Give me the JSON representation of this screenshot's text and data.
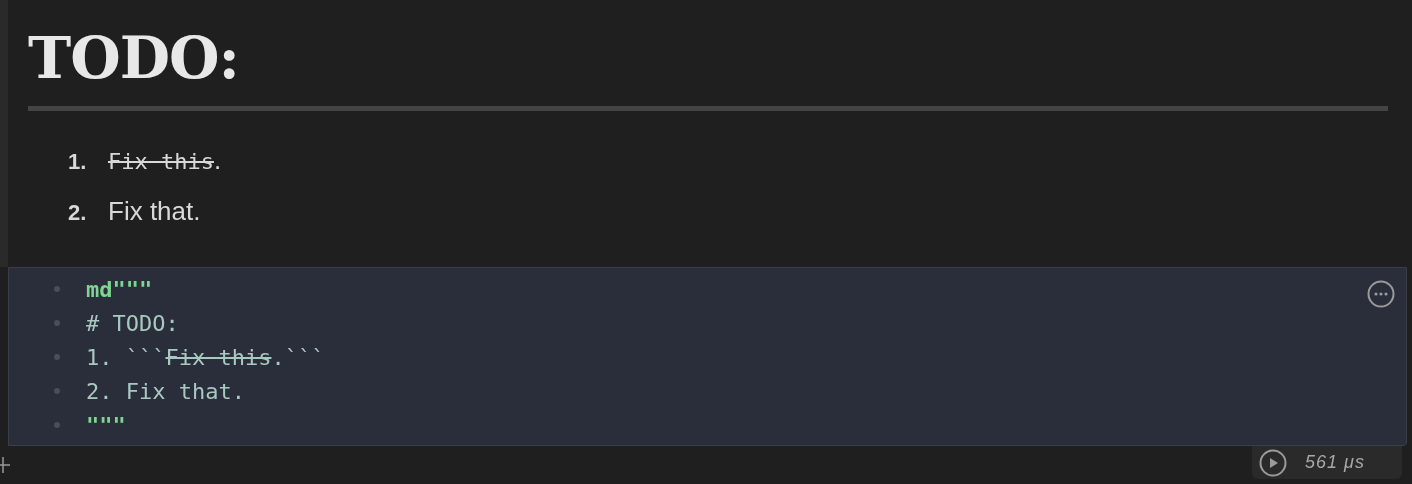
{
  "output": {
    "heading": "TODO:",
    "list": [
      {
        "number": "1.",
        "segments": [
          {
            "text": "Fix this",
            "kind": "code_strike"
          },
          {
            "text": ".",
            "kind": "plain"
          }
        ]
      },
      {
        "number": "2.",
        "segments": [
          {
            "text": "Fix that.",
            "kind": "plain"
          }
        ]
      }
    ]
  },
  "code_cell": {
    "lines": [
      [
        {
          "text": "md\"\"\"",
          "kind": "string"
        }
      ],
      [
        {
          "text": "# TODO:",
          "kind": "plain"
        }
      ],
      [
        {
          "text": "1. ```",
          "kind": "plain"
        },
        {
          "text": "Fix this",
          "kind": "strike"
        },
        {
          "text": ".```",
          "kind": "plain"
        }
      ],
      [
        {
          "text": "2. Fix that.",
          "kind": "plain"
        }
      ],
      [
        {
          "text": "\"\"\"",
          "kind": "string"
        }
      ]
    ]
  },
  "run_status": {
    "time": "561 μs"
  }
}
